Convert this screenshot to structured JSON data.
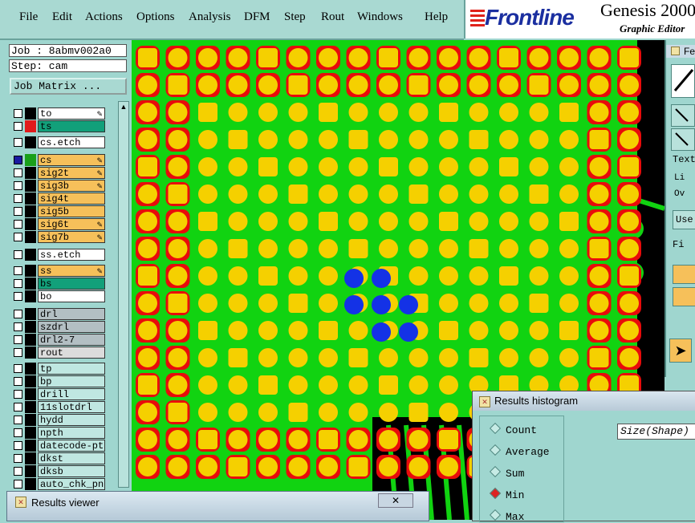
{
  "menubar": {
    "items": [
      "File",
      "Edit",
      "Actions",
      "Options",
      "Analysis",
      "DFM",
      "Step",
      "Rout",
      "Windows",
      "Help"
    ]
  },
  "brand": {
    "logo": "Frontline",
    "title": "Genesis 2000",
    "subtitle": "Graphic Editor"
  },
  "job": {
    "job_label": "Job : 8abmv002a0",
    "step_label": "Step: cam",
    "job_matrix_button": "Job Matrix ..."
  },
  "layers": [
    {
      "name": "to",
      "color": "#ffffff",
      "checked": false,
      "mark": "#000000",
      "lock": true
    },
    {
      "name": "ts",
      "color": "#12a07a",
      "checked": false,
      "mark": "#e11b1b",
      "lock": false
    },
    {
      "name": "cs.etch",
      "color": "#ffffff",
      "checked": false,
      "mark": "#000000",
      "lock": false
    },
    {
      "name": "cs",
      "color": "#f6c05a",
      "checked": true,
      "mark": "#1aa01a",
      "lock": true
    },
    {
      "name": "sig2t",
      "color": "#f6c05a",
      "checked": false,
      "mark": "#000000",
      "lock": true
    },
    {
      "name": "sig3b",
      "color": "#f6c05a",
      "checked": false,
      "mark": "#000000",
      "lock": true
    },
    {
      "name": "sig4t",
      "color": "#f6c05a",
      "checked": false,
      "mark": "#000000",
      "lock": false
    },
    {
      "name": "sig5b",
      "color": "#f6c05a",
      "checked": false,
      "mark": "#000000",
      "lock": false
    },
    {
      "name": "sig6t",
      "color": "#f6c05a",
      "checked": false,
      "mark": "#000000",
      "lock": true
    },
    {
      "name": "sig7b",
      "color": "#f6c05a",
      "checked": false,
      "mark": "#000000",
      "lock": true
    },
    {
      "name": "ss.etch",
      "color": "#ffffff",
      "checked": false,
      "mark": "#000000",
      "lock": false
    },
    {
      "name": "ss",
      "color": "#f6c05a",
      "checked": false,
      "mark": "#000000",
      "lock": true
    },
    {
      "name": "bs",
      "color": "#12a07a",
      "checked": false,
      "mark": "#000000",
      "lock": false
    },
    {
      "name": "bo",
      "color": "#ffffff",
      "checked": false,
      "mark": "#000000",
      "lock": false
    },
    {
      "name": "drl",
      "color": "#b3bfc3",
      "checked": false,
      "mark": "#000000",
      "lock": false
    },
    {
      "name": "szdrl",
      "color": "#b3bfc3",
      "checked": false,
      "mark": "#000000",
      "lock": false
    },
    {
      "name": "drl2-7",
      "color": "#b3bfc3",
      "checked": false,
      "mark": "#000000",
      "lock": false
    },
    {
      "name": "rout",
      "color": "#dcdcdc",
      "checked": false,
      "mark": "#000000",
      "lock": false
    },
    {
      "name": "tp",
      "color": "#bfe7e1",
      "checked": false,
      "mark": "#000000",
      "lock": false
    },
    {
      "name": "bp",
      "color": "#bfe7e1",
      "checked": false,
      "mark": "#000000",
      "lock": false
    },
    {
      "name": "drill",
      "color": "#bfe7e1",
      "checked": false,
      "mark": "#000000",
      "lock": false
    },
    {
      "name": "11slotdrl",
      "color": "#bfe7e1",
      "checked": false,
      "mark": "#000000",
      "lock": false
    },
    {
      "name": "hydd",
      "color": "#bfe7e1",
      "checked": false,
      "mark": "#000000",
      "lock": false
    },
    {
      "name": "npth",
      "color": "#bfe7e1",
      "checked": false,
      "mark": "#000000",
      "lock": false
    },
    {
      "name": "datecode-pte",
      "color": "#bfe7e1",
      "checked": false,
      "mark": "#000000",
      "lock": false
    },
    {
      "name": "dkst",
      "color": "#bfe7e1",
      "checked": false,
      "mark": "#000000",
      "lock": false
    },
    {
      "name": "dksb",
      "color": "#bfe7e1",
      "checked": false,
      "mark": "#000000",
      "lock": false
    },
    {
      "name": "auto_chk_pni",
      "color": "#bfe7e1",
      "checked": false,
      "mark": "#000000",
      "lock": false
    }
  ],
  "board": {
    "colors": {
      "background": "#000000",
      "copper": "#11d311",
      "pad": "#f5d000",
      "outline": "#e80b0b",
      "highlight": "#1432e6"
    }
  },
  "right_panel": {
    "title_fragment": "Fe",
    "text_label": "Text",
    "opt1": "Li",
    "opt2": "Ov",
    "user_label": "Use",
    "check_label": "Fi"
  },
  "histogram": {
    "title": "Results histogram",
    "options": [
      "Count",
      "Average",
      "Sum",
      "Min",
      "Max"
    ],
    "selected": "Min",
    "field": "Size(Shape)"
  },
  "viewer": {
    "title": "Results viewer",
    "close": "✕"
  }
}
